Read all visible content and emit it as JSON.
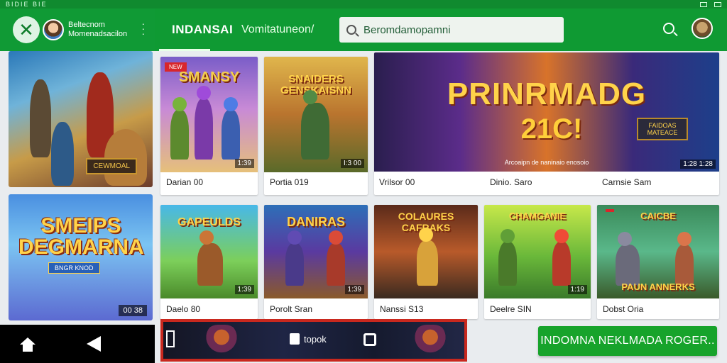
{
  "status_bar": {
    "left": "BIDIE BIE",
    "right": ""
  },
  "left_header": {
    "line1": "Beltecnom",
    "line2": "Momenadsacilon"
  },
  "header": {
    "brand": "INDANSAI",
    "subtitle": "Vomitatuneon/",
    "search_text": "Beromdamopamni"
  },
  "left_cards": {
    "card1_tag": "CEWMOAL",
    "card2_title_line1": "SMEIPS",
    "card2_title_line2": "DEGMARNA",
    "card2_sub": "BNGR KNOD",
    "card2_badge": "00 38"
  },
  "games": [
    {
      "caption": "Darian 00",
      "badge": "1:39",
      "title": "SMANSY",
      "chip": "NEW"
    },
    {
      "caption": "Portia 019",
      "badge": "I:3 00",
      "title": "SNAIDERS GENSKAISNN"
    },
    {
      "caption": "Vrilsor 00",
      "badge": "1:28 1:28",
      "title": "PRINRMADG",
      "title2": "21C!",
      "sub": "Arcoaipn de naninaio enosoio",
      "plate": "FAIDOAS MATEACE"
    },
    {
      "caption": "Dinio. Saro",
      "badge": ""
    },
    {
      "caption": "Carnsie Sam",
      "badge": ""
    },
    {
      "caption": "Daelo 80",
      "badge": "1:39",
      "title": "GAPEULDS"
    },
    {
      "caption": "Porolt Sran",
      "badge": "1:39",
      "title": "DANIRAS"
    },
    {
      "caption": "Nanssi S13",
      "badge": "",
      "title": "COLAURES CAFRAKS"
    },
    {
      "caption": "Deelre SIN",
      "badge": "1:19",
      "title": "CHAMGANIE"
    },
    {
      "caption": "Dobst Oria",
      "badge": "",
      "title": "CAICBE",
      "title2": "PAUN ANNERKS"
    }
  ],
  "ad_banner": {
    "label": "topok"
  },
  "cta": {
    "label": "INDOMNA NEKLMADA ROGER.."
  }
}
